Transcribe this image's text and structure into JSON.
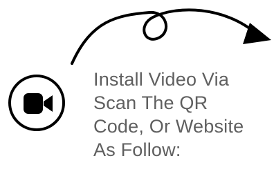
{
  "instruction": {
    "lines": [
      "Install Video Via",
      "Scan The QR",
      "Code, Or Website",
      "As Follow:"
    ]
  },
  "icons": {
    "video": "video-camera-icon",
    "arrow": "curved-arrow-icon"
  },
  "colors": {
    "icon": "#000000",
    "text": "#5f5f5f",
    "background": "#ffffff"
  }
}
